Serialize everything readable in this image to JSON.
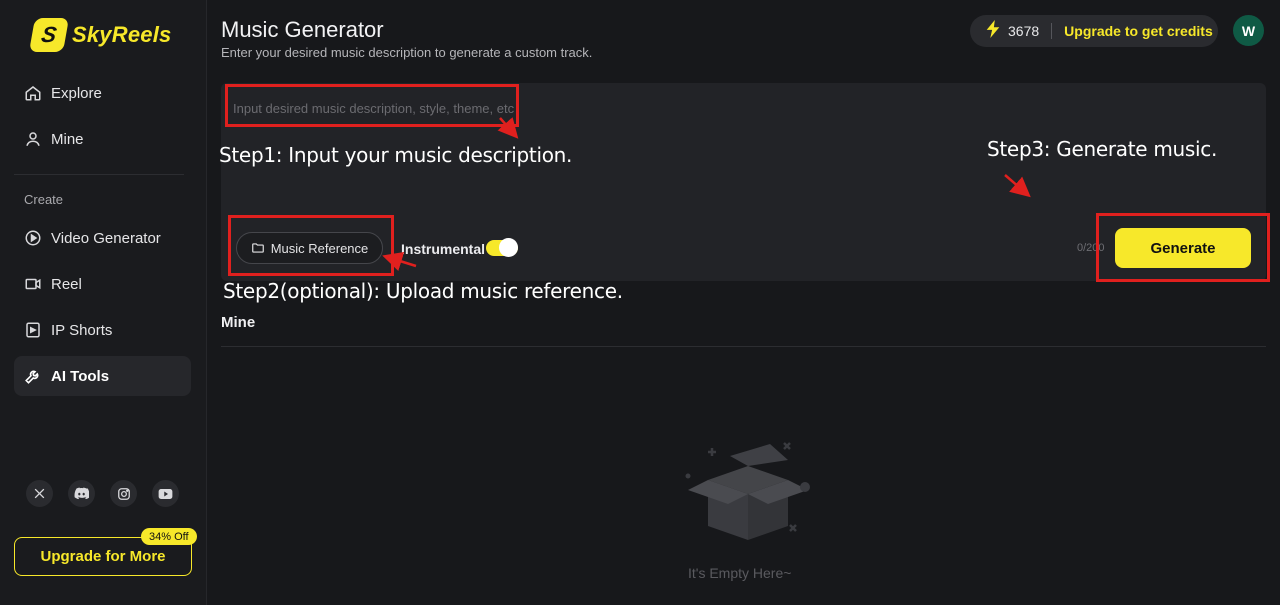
{
  "brand": {
    "logo_letter": "S",
    "name": "SkyReels"
  },
  "sidebar": {
    "nav": [
      {
        "label": "Explore",
        "icon": "home-icon"
      },
      {
        "label": "Mine",
        "icon": "user-icon"
      }
    ],
    "section_label": "Create",
    "create_items": [
      {
        "label": "Video Generator",
        "icon": "play-circle-icon"
      },
      {
        "label": "Reel",
        "icon": "video-camera-icon"
      },
      {
        "label": "IP Shorts",
        "icon": "film-icon"
      },
      {
        "label": "AI Tools",
        "icon": "wrench-icon",
        "active": true
      }
    ],
    "socials": [
      "x-icon",
      "discord-icon",
      "instagram-icon",
      "youtube-icon"
    ],
    "upgrade_label": "Upgrade for More",
    "discount_badge": "34% Off"
  },
  "header": {
    "title": "Music Generator",
    "subtitle": "Enter your desired music description to generate a custom track.",
    "credits": "3678",
    "upgrade_link": "Upgrade to get credits",
    "avatar_initial": "W"
  },
  "composer": {
    "prompt_placeholder": "Input desired music description, style, theme, etc",
    "prompt_value": "",
    "music_reference_label": "Music Reference",
    "instrumental_label": "Instrumental",
    "instrumental_on": true,
    "char_count": "0/200",
    "generate_label": "Generate"
  },
  "annotations": {
    "step1": "Step1: Input your music description.",
    "step2": "Step2(optional): Upload music reference.",
    "step3": "Step3: Generate music."
  },
  "mine": {
    "heading": "Mine",
    "empty_text": "It's Empty Here~"
  },
  "colors": {
    "accent": "#f7e82a",
    "background": "#17181b",
    "annotation_red": "#e0201e",
    "avatar_bg": "#0f5a45"
  }
}
